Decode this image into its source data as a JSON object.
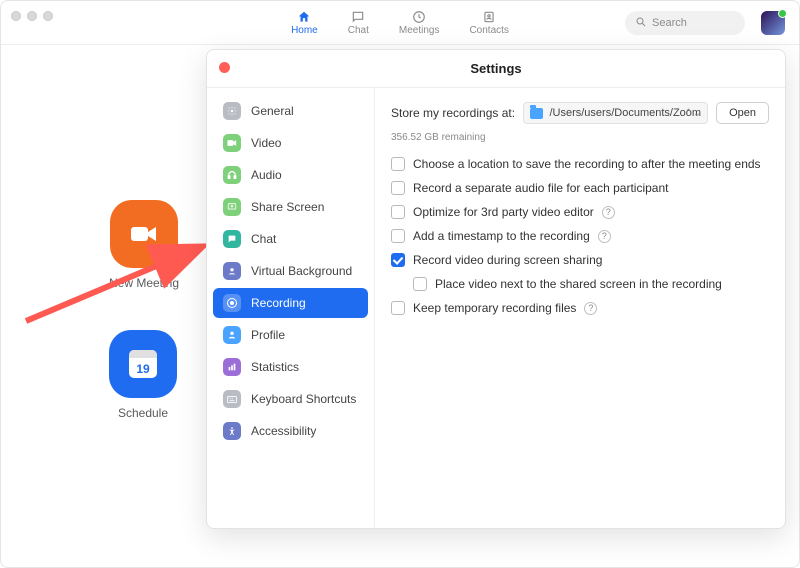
{
  "nav": {
    "home": "Home",
    "chat": "Chat",
    "meetings": "Meetings",
    "contacts": "Contacts"
  },
  "search": {
    "placeholder": "Search"
  },
  "home_tiles": {
    "new_meeting": "New Meeting",
    "schedule": "Schedule",
    "calendar_day": "19"
  },
  "settings": {
    "title": "Settings",
    "sidebar": {
      "general": "General",
      "video": "Video",
      "audio": "Audio",
      "share_screen": "Share Screen",
      "chat": "Chat",
      "virtual_background": "Virtual Background",
      "recording": "Recording",
      "profile": "Profile",
      "statistics": "Statistics",
      "keyboard_shortcuts": "Keyboard Shortcuts",
      "accessibility": "Accessibility"
    },
    "content": {
      "store_label": "Store my recordings at:",
      "path": "/Users/users/Documents/Zoom",
      "open": "Open",
      "remaining": "356.52 GB remaining",
      "opt1": "Choose a location to save the recording to after the meeting ends",
      "opt2": "Record a separate audio file for each participant",
      "opt3": "Optimize for 3rd party video editor",
      "opt4": "Add a timestamp to the recording",
      "opt5": "Record video during screen sharing",
      "opt5a": "Place video next to the shared screen in the recording",
      "opt6": "Keep temporary recording files",
      "help": "?"
    }
  },
  "icon_colors": {
    "general": "#b9bcc2",
    "video": "#7ed07a",
    "audio": "#7ed07a",
    "share_screen": "#7ed07a",
    "chat": "#31b6a0",
    "virtual_background": "#6c7ac8",
    "recording": "#ffffff",
    "profile": "#4aa3ff",
    "statistics": "#9b6dd7",
    "keyboard_shortcuts": "#b9bcc2",
    "accessibility": "#6c7ac8"
  }
}
